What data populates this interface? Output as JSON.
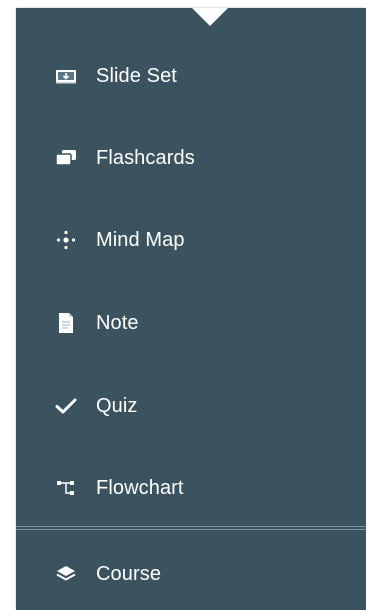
{
  "menu": {
    "items": [
      {
        "label": "Slide Set",
        "icon": "slide-set-icon"
      },
      {
        "label": "Flashcards",
        "icon": "flashcards-icon"
      },
      {
        "label": "Mind Map",
        "icon": "mind-map-icon"
      },
      {
        "label": "Note",
        "icon": "note-icon"
      },
      {
        "label": "Quiz",
        "icon": "check-icon"
      },
      {
        "label": "Flowchart",
        "icon": "flowchart-icon"
      }
    ],
    "footer_item": {
      "label": "Course",
      "icon": "course-layers-icon"
    }
  },
  "colors": {
    "menu_background": "#3a535f",
    "text": "#ffffff",
    "divider": "#7c929d"
  }
}
